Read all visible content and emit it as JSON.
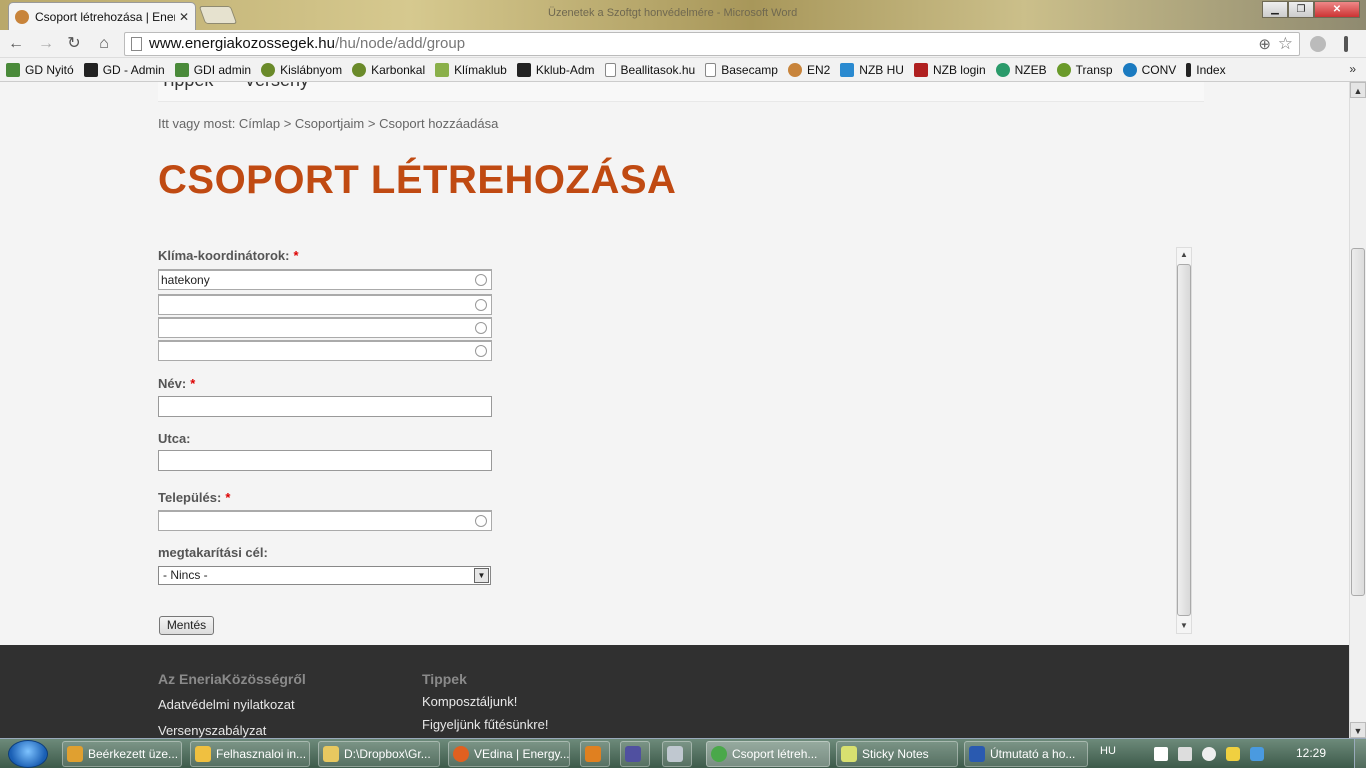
{
  "browser": {
    "tab_title": "Csoport létrehozása | Ener",
    "window_title": "Üzenetek a Szoftgt honvédelmére - Microsoft Word",
    "url_host": "www.energiakozossegek.hu",
    "url_path": "/hu/node/add/group",
    "bookmarks": [
      {
        "label": "GD Nyitó",
        "color": "#4a8a3a"
      },
      {
        "label": "GD - Admin",
        "color": "#222222"
      },
      {
        "label": "GDI admin",
        "color": "#4a8a3a"
      },
      {
        "label": "Kislábnyom",
        "color": "#6a8a2a"
      },
      {
        "label": "Karbonkal",
        "color": "#6a8a2a"
      },
      {
        "label": "Klímaklub",
        "color": "#8ab04a"
      },
      {
        "label": "Kklub-Adm",
        "color": "#222222"
      },
      {
        "label": "Beallitasok.hu",
        "color": "#ffffff"
      },
      {
        "label": "Basecamp",
        "color": "#ffffff"
      },
      {
        "label": "EN2",
        "color": "#c8843b"
      },
      {
        "label": "NZB HU",
        "color": "#2a8ad0"
      },
      {
        "label": "NZB login",
        "color": "#b02020"
      },
      {
        "label": "NZEB",
        "color": "#2a9a6a"
      },
      {
        "label": "Transp",
        "color": "#6a9a2a"
      },
      {
        "label": "CONV",
        "color": "#1a7ac0"
      },
      {
        "label": "Index",
        "color": "#222222"
      }
    ],
    "bookmarks_more": "»"
  },
  "page": {
    "topnav_items": [
      "Tippek",
      "Verseny"
    ],
    "breadcrumb": "Itt vagy most: Címlap > Csoportjaim > Csoport hozzáadása",
    "title": "CSOPORT LÉTREHOZÁSA",
    "form": {
      "coordinators_label": "Klíma-koordinátorok:",
      "coordinators_values": [
        "hatekony",
        "",
        "",
        ""
      ],
      "name_label": "Név:",
      "street_label": "Utca:",
      "town_label": "Település:",
      "target_label": "megtakarítási cél:",
      "target_selected": "- Nincs -",
      "required_mark": "*",
      "save_label": "Mentés"
    },
    "footer": {
      "col1_title": "Az EneriaKözösségről",
      "col1_links": [
        "Adatvédelmi nyilatkozat",
        "Versenyszabályzat"
      ],
      "col2_title": "Tippek",
      "col2_links": [
        "Komposztáljunk!",
        "Figyeljünk fűtésünkre!"
      ]
    }
  },
  "taskbar": {
    "tasks": [
      {
        "label": "Beérkezett üze...",
        "color": "#e0a030"
      },
      {
        "label": "Felhasznaloi in...",
        "color": "#f0c040"
      },
      {
        "label": "D:\\Dropbox\\Gr...",
        "color": "#e8c860"
      },
      {
        "label": "VEdina | Energy...",
        "color": "#e06020"
      },
      {
        "label": "Csoport létreh...",
        "color": "#4aa84a"
      },
      {
        "label": "Sticky Notes",
        "color": "#d8e070"
      },
      {
        "label": "Útmutató a ho...",
        "color": "#2a5ab0"
      }
    ],
    "language": "HU",
    "clock": "12:29"
  }
}
